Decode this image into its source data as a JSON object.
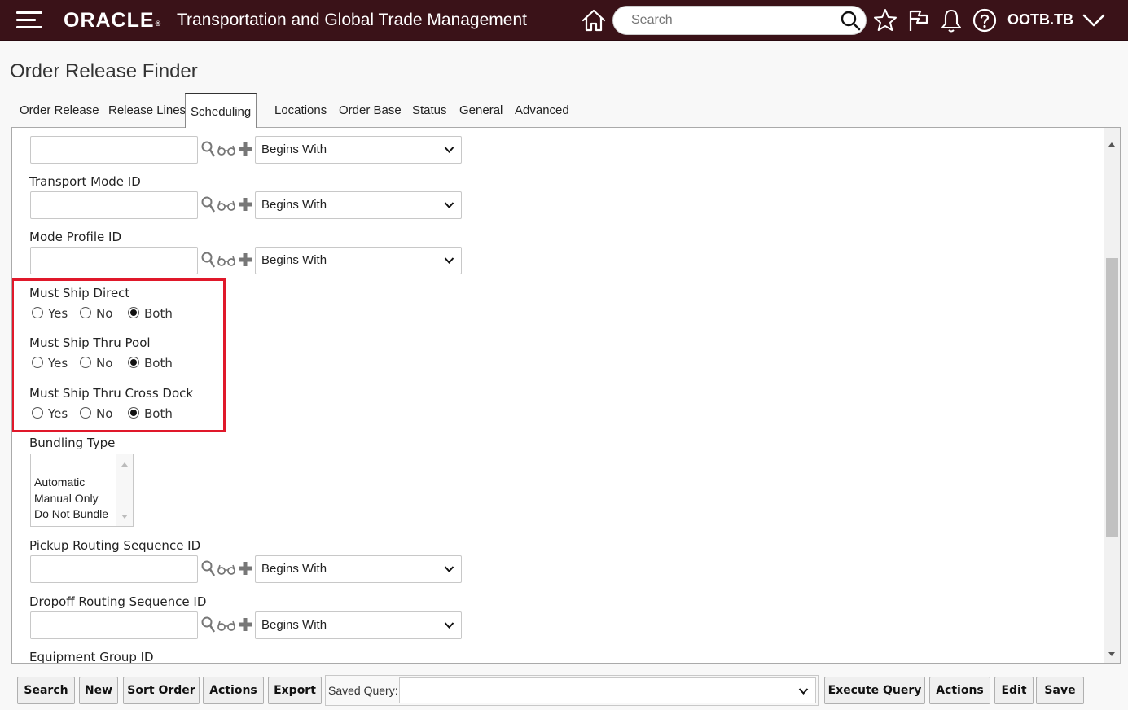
{
  "header": {
    "brand": "ORACLE",
    "app_title": "Transportation and Global Trade Management",
    "search_placeholder": "Search",
    "user": "OOTB.TB",
    "icons": [
      "menu-icon",
      "home-icon",
      "search-icon",
      "star-icon",
      "flag-icon",
      "bell-icon",
      "help-icon",
      "chevron-down-icon"
    ],
    "color": "#3a1218"
  },
  "page": {
    "title": "Order Release Finder"
  },
  "tabs": [
    {
      "label": "Order Release"
    },
    {
      "label": "Release Lines"
    },
    {
      "label": "Scheduling",
      "active": true
    },
    {
      "label": "Locations"
    },
    {
      "label": "Order Base"
    },
    {
      "label": "Status"
    },
    {
      "label": "General"
    },
    {
      "label": "Advanced"
    }
  ],
  "form": {
    "top_row": {
      "value": "",
      "operator": "Begins With"
    },
    "transport_mode": {
      "label": "Transport Mode ID",
      "value": "",
      "operator": "Begins With"
    },
    "mode_profile": {
      "label": "Mode Profile ID",
      "value": "",
      "operator": "Begins With"
    },
    "must_ship_direct": {
      "label": "Must Ship Direct",
      "options": [
        "Yes",
        "No",
        "Both"
      ],
      "selected": "Both"
    },
    "must_ship_thru_pool": {
      "label": "Must Ship Thru Pool",
      "options": [
        "Yes",
        "No",
        "Both"
      ],
      "selected": "Both"
    },
    "must_ship_thru_cross_dock": {
      "label": "Must Ship Thru Cross Dock",
      "options": [
        "Yes",
        "No",
        "Both"
      ],
      "selected": "Both"
    },
    "bundling_type": {
      "label": "Bundling Type",
      "options": [
        "Automatic",
        "Manual Only",
        "Do Not Bundle"
      ]
    },
    "pickup_routing": {
      "label": "Pickup Routing Sequence ID",
      "value": "",
      "operator": "Begins With"
    },
    "dropoff_routing": {
      "label": "Dropoff Routing Sequence ID",
      "value": "",
      "operator": "Begins With"
    },
    "equipment_group": {
      "label": "Equipment Group ID"
    },
    "highlight_color": "#e0182a"
  },
  "toolbar": {
    "search": "Search",
    "new": "New",
    "sort_order": "Sort Order",
    "actions": "Actions",
    "export": "Export",
    "saved_query_label": "Saved Query:",
    "saved_query_value": "",
    "execute_query": "Execute Query",
    "actions2": "Actions",
    "edit": "Edit",
    "save": "Save"
  }
}
